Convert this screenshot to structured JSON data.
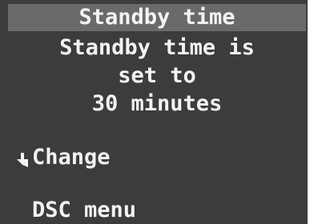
{
  "screen": {
    "title": "Standby time",
    "message_lines": [
      "Standby time is",
      "set to",
      "30 minutes"
    ],
    "menu": {
      "change_label": "Change",
      "change_icon": "select-cursor-icon",
      "dsc_label": "DSC menu"
    }
  }
}
